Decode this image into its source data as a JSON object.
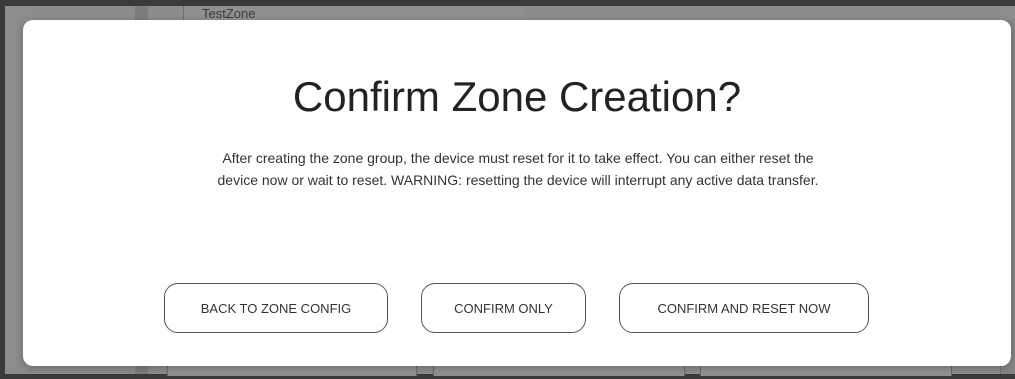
{
  "background": {
    "zone_name_field": "TestZone"
  },
  "dialog": {
    "title": "Confirm Zone Creation?",
    "message": "After creating the zone group, the device must reset for it to take effect. You can either reset the device now or wait to reset. WARNING: resetting the device will interrupt any active data transfer.",
    "buttons": {
      "back": "BACK TO ZONE CONFIG",
      "confirm_only": "CONFIRM ONLY",
      "confirm_reset": "CONFIRM AND RESET NOW"
    }
  },
  "colors": {
    "overlay": "#8c8c8c",
    "dialog_background": "#ffffff",
    "title_text": "#222222",
    "button_border": "#555555"
  }
}
